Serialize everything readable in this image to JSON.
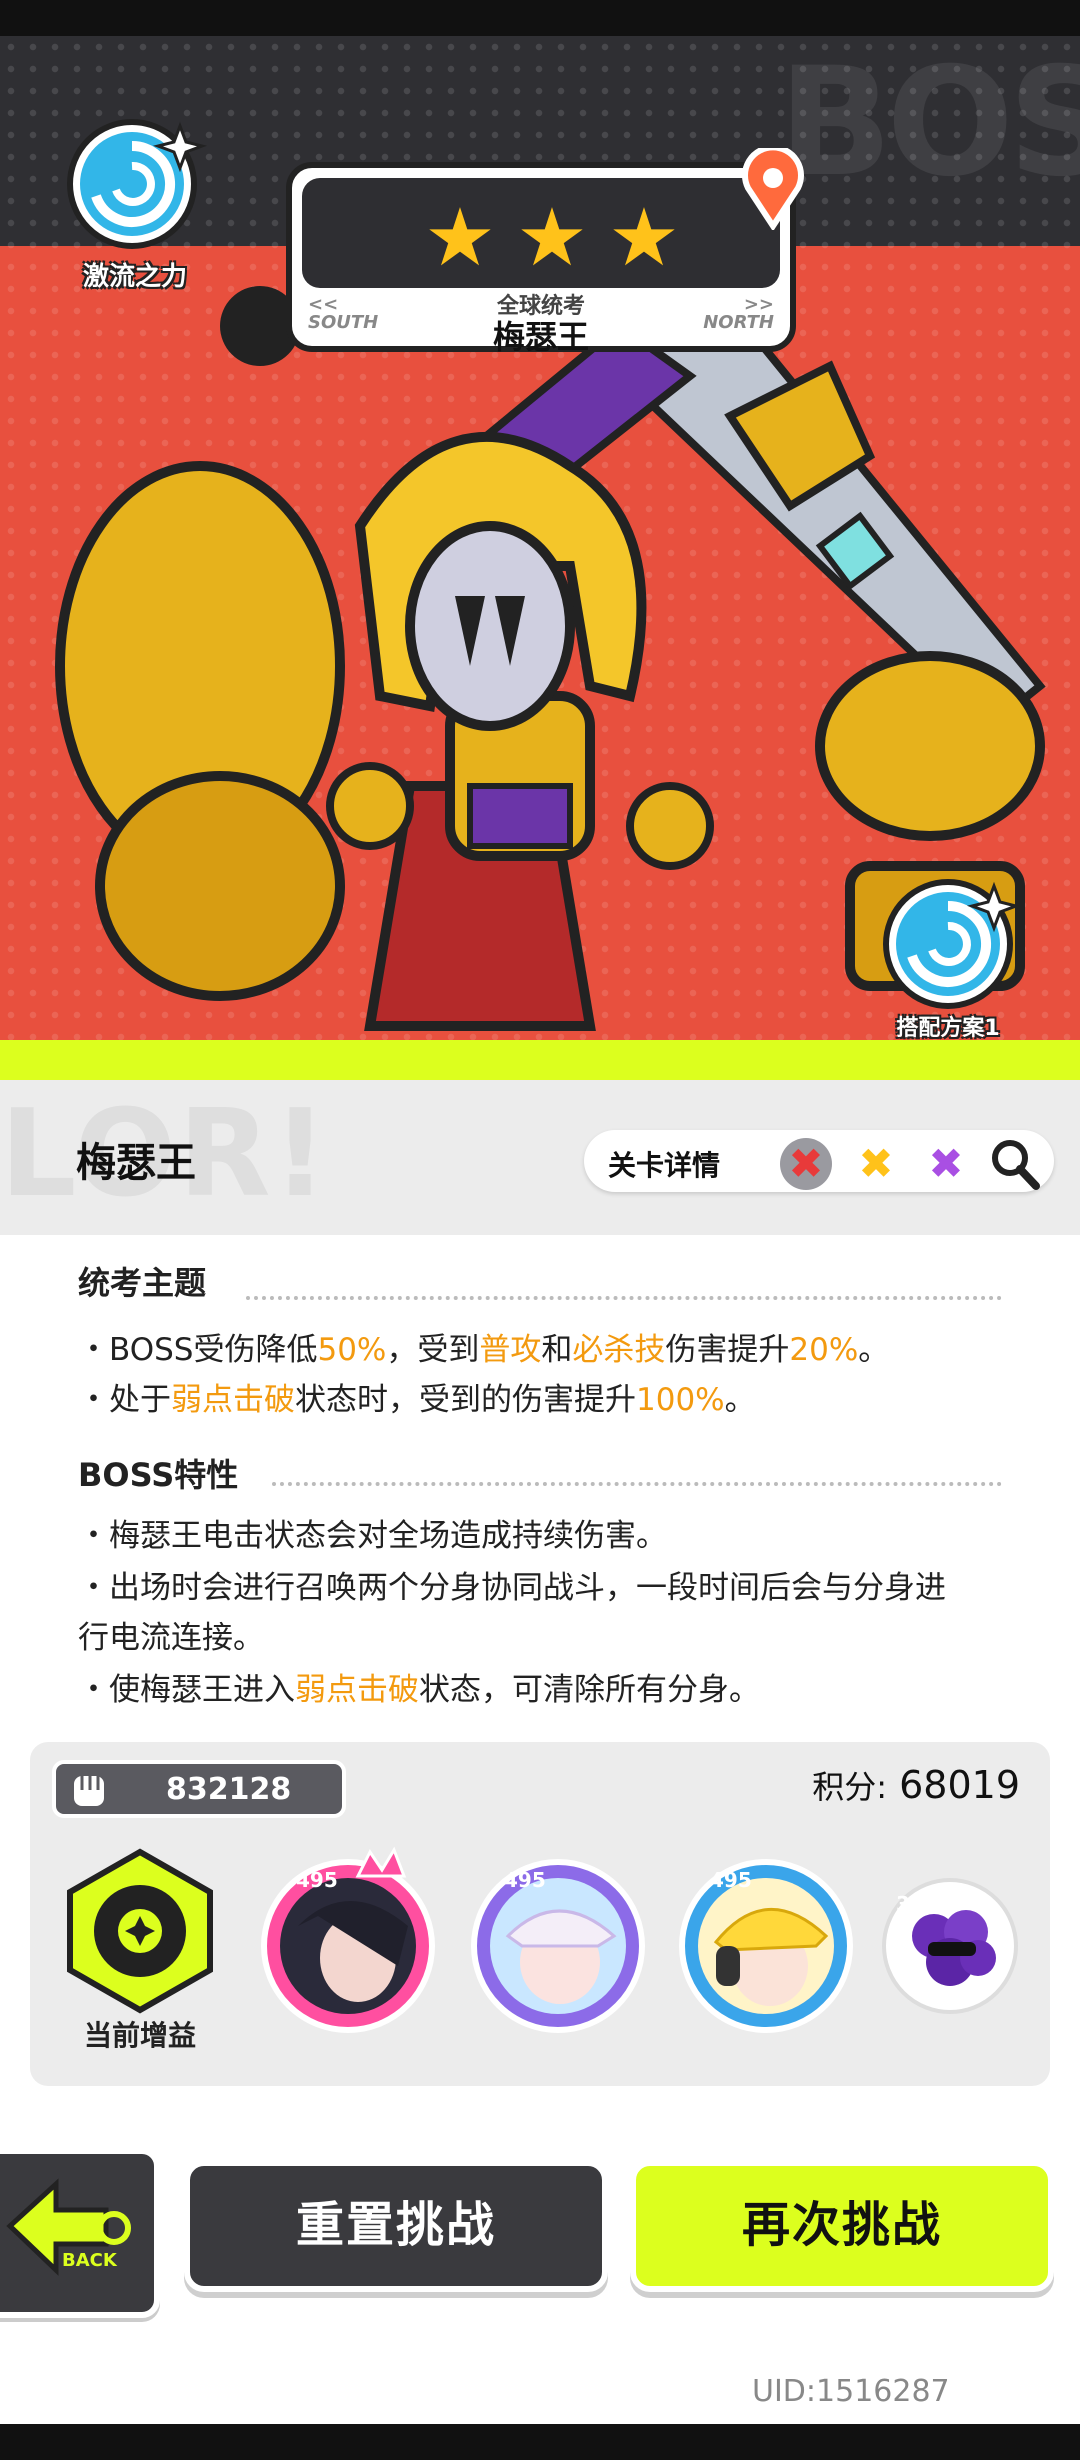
{
  "hero": {
    "power_label": "激流之力",
    "subtitle": "全球统考",
    "boss_name_card": "梅瑟王",
    "dir_left_arrows": "<<",
    "dir_left": "SOUTH",
    "dir_right_arrows": ">>",
    "dir_right": "NORTH",
    "stars": 3,
    "loadout_label": "搭配方案1",
    "watermark": "BOS"
  },
  "info": {
    "boss_name": "梅瑟王",
    "detail_label": "关卡详情",
    "elements": [
      "✖",
      "✖",
      "✖"
    ],
    "bg_text": "LOR!"
  },
  "theme": {
    "title": "统考主题",
    "line1": {
      "p1": "・BOSS受伤降低",
      "h1": "50%",
      "p2": "，受到",
      "h2": "普攻",
      "p3": "和",
      "h3": "必杀技",
      "p4": "伤害提升",
      "h4": "20%",
      "p5": "。"
    },
    "line2": {
      "p1": "・处于",
      "h1": "弱点击破",
      "p2": "状态时，受到的伤害提升",
      "h2": "100%",
      "p3": "。"
    }
  },
  "traits": {
    "title": "BOSS特性",
    "line1": "・梅瑟王电击状态会对全场造成持续伤害。",
    "line2a": "・出场时会进行召唤两个分身协同战斗，一段时间后会与分身进",
    "line2b": "行电流连接。",
    "line3": {
      "p1": "・使梅瑟王进入",
      "h1": "弱点击破",
      "p2": "状态，可清除所有分身。"
    }
  },
  "team": {
    "ticket": "832128",
    "score_label": "积分:",
    "score": "68019",
    "buff_label": "当前增益",
    "members": [
      {
        "level": "495",
        "icon": "dark-hair-hero-avatar"
      },
      {
        "level": "495",
        "icon": "white-hair-hero-avatar"
      },
      {
        "level": "495",
        "icon": "blonde-hero-avatar"
      },
      {
        "level": "36",
        "icon": "grape-pet-avatar"
      }
    ]
  },
  "buttons": {
    "back": "BACK",
    "reset": "重置挑战",
    "retry": "再次挑战"
  },
  "uid": "UID:1516287",
  "colors": {
    "accent": "#dcff1e",
    "highlight": "#f39a0f",
    "hero_red": "#e8503e",
    "dark": "#3a3a3e"
  }
}
